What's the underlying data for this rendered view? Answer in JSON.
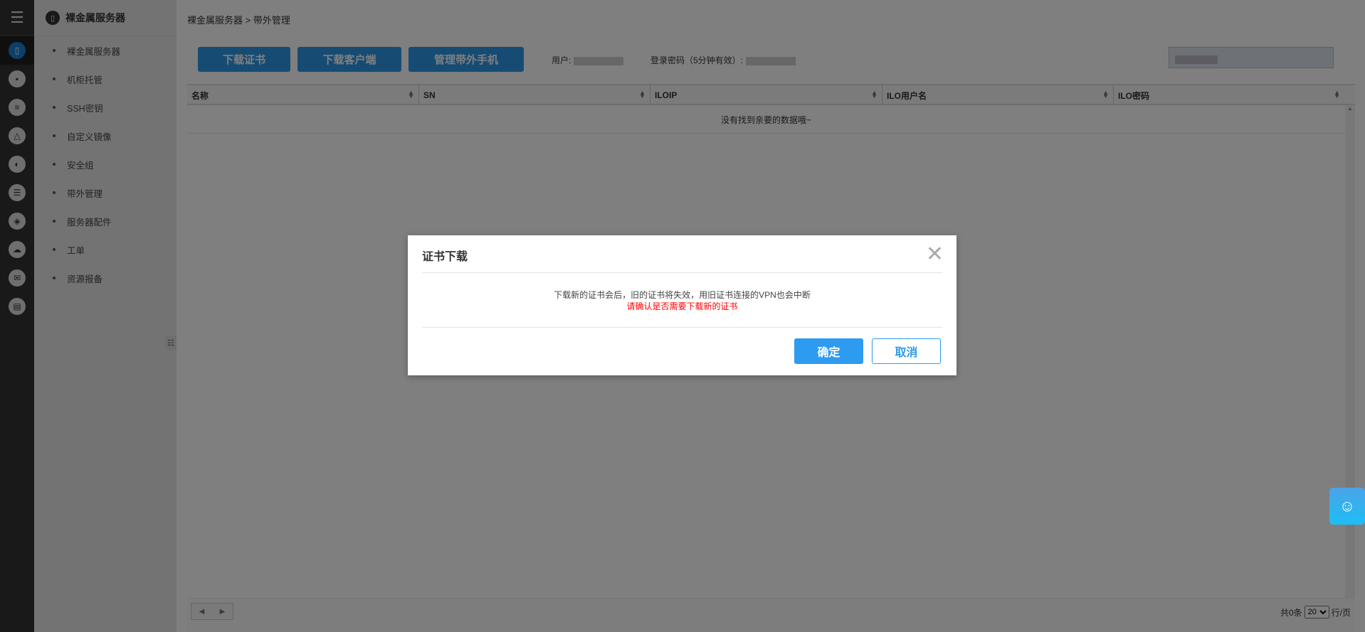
{
  "sidebar": {
    "title": "裸金属服务器",
    "items": [
      {
        "label": "裸金属服务器"
      },
      {
        "label": "机柜托管"
      },
      {
        "label": "SSH密钥"
      },
      {
        "label": "自定义镜像"
      },
      {
        "label": "安全组"
      },
      {
        "label": "带外管理"
      },
      {
        "label": "服务器配件"
      },
      {
        "label": "工单"
      },
      {
        "label": "资源报备"
      }
    ]
  },
  "breadcrumb": "裸金属服务器 > 带外管理",
  "toolbar": {
    "download_cert": "下载证书",
    "download_client": "下载客户端",
    "manage_phone": "管理带外手机",
    "user_label": "用户:",
    "password_label": "登录密码（5分钟有效）:"
  },
  "table": {
    "columns": [
      "名称",
      "SN",
      "ILOIP",
      "ILO用户名",
      "ILO密码"
    ],
    "empty_text": "没有找到亲要的数据哦~"
  },
  "pager": {
    "total": "共0条",
    "page_size": "20",
    "unit": "行/页"
  },
  "modal": {
    "title": "证书下载",
    "message": "下载新的证书会后，旧的证书将失效，用旧证书连接的VPN也会中断",
    "warning": "请确认是否需要下载新的证书",
    "ok": "确定",
    "cancel": "取消"
  }
}
